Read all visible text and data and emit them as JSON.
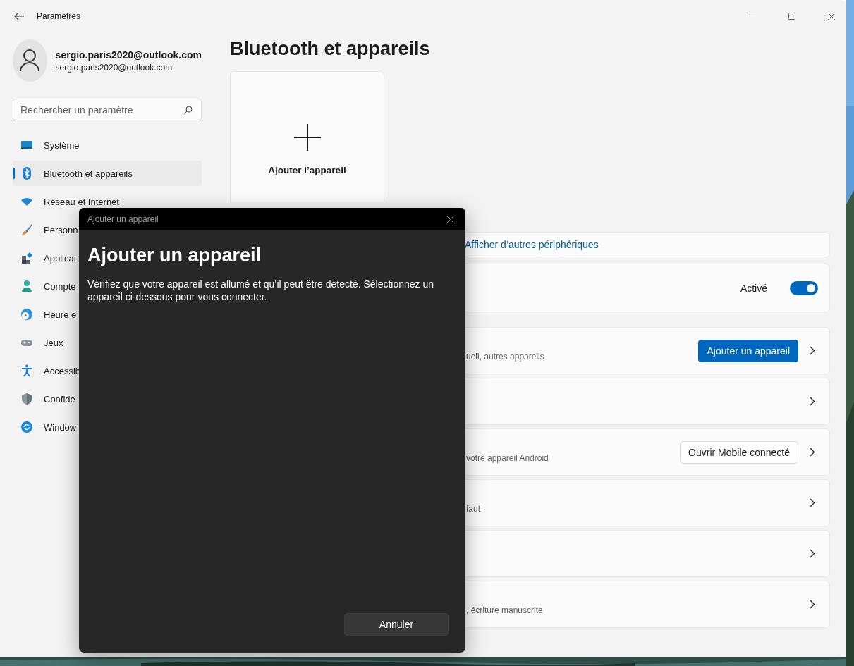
{
  "window": {
    "title": "Paramètres"
  },
  "profile": {
    "name": "sergio.paris2020@outlook.com",
    "email": "sergio.paris2020@outlook.com"
  },
  "search": {
    "placeholder": "Rechercher un paramètre"
  },
  "nav": [
    {
      "label": "Système",
      "selected": false
    },
    {
      "label": "Bluetooth et appareils",
      "selected": true
    },
    {
      "label": "Réseau et Internet",
      "selected": false
    },
    {
      "label": "Personn",
      "selected": false
    },
    {
      "label": "Applicat",
      "selected": false
    },
    {
      "label": "Compte",
      "selected": false
    },
    {
      "label": "Heure e",
      "selected": false
    },
    {
      "label": "Jeux",
      "selected": false
    },
    {
      "label": "Accessib",
      "selected": false
    },
    {
      "label": "Confide",
      "selected": false
    },
    {
      "label": "Window",
      "selected": false
    }
  ],
  "page": {
    "title": "Bluetooth et appareils",
    "add_tile": {
      "label": "Ajouter l’appareil"
    },
    "more_link": "Afficher d’autres périphériques",
    "bluetooth": {
      "state_label": "Activé",
      "on": true
    },
    "rows": [
      {
        "subtitle": "ueil, autres appareils",
        "button": {
          "label": "Ajouter un appareil",
          "kind": "primary"
        }
      },
      {},
      {
        "subtitle": "votre appareil Android",
        "button": {
          "label": "Ouvrir Mobile connecté",
          "kind": "secondary"
        }
      },
      {
        "subtitle": "faut"
      },
      {},
      {
        "subtitle": ", écriture manuscrite"
      }
    ]
  },
  "dialog": {
    "title": "Ajouter un appareil",
    "heading": "Ajouter un appareil",
    "text": "Vérifiez que votre appareil est allumé et qu’il peut être détecté. Sélectionnez un appareil ci-dessous pour vous connecter.",
    "cancel": "Annuler"
  }
}
